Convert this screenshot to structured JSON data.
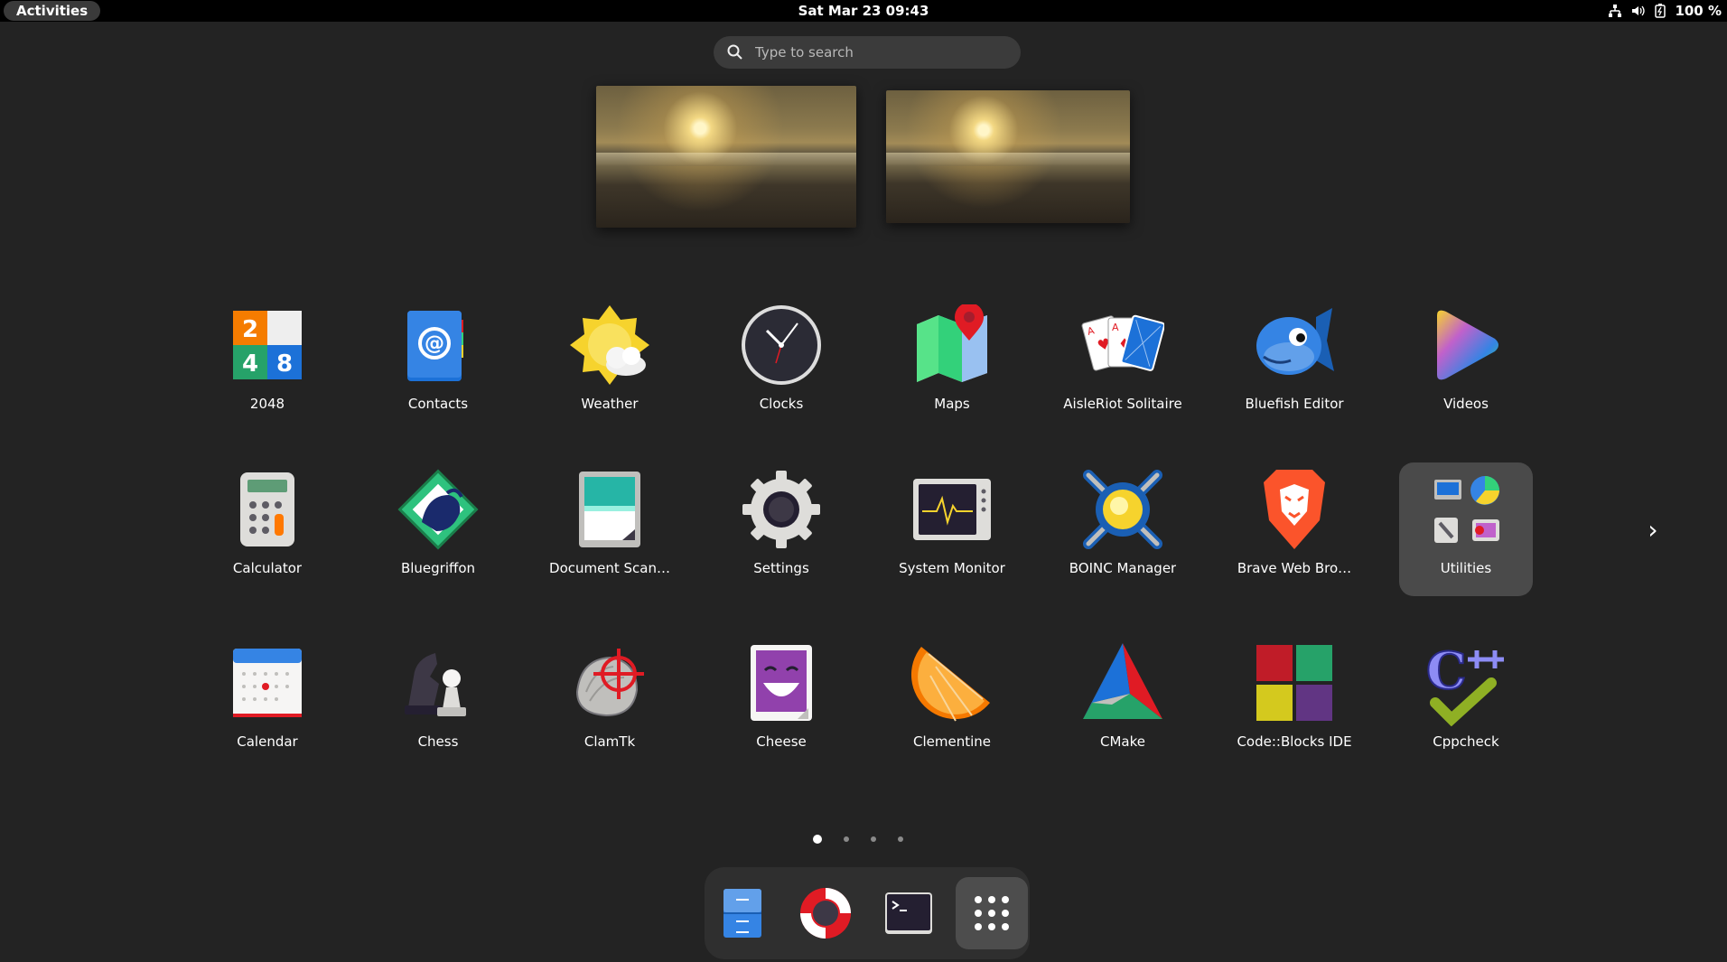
{
  "topbar": {
    "activities_label": "Activities",
    "clock": "Sat Mar 23  09:43",
    "battery": "100 %",
    "icons": [
      "network-icon",
      "volume-icon",
      "battery-icon"
    ]
  },
  "search": {
    "placeholder": "Type to search"
  },
  "apps": [
    {
      "label": "2048",
      "icon": "2048-icon"
    },
    {
      "label": "Contacts",
      "icon": "contacts-icon"
    },
    {
      "label": "Weather",
      "icon": "weather-icon"
    },
    {
      "label": "Clocks",
      "icon": "clock-icon"
    },
    {
      "label": "Maps",
      "icon": "maps-icon"
    },
    {
      "label": "AisleRiot Solitaire",
      "icon": "cards-icon"
    },
    {
      "label": "Bluefish Editor",
      "icon": "bluefish-icon"
    },
    {
      "label": "Videos",
      "icon": "videos-icon"
    },
    {
      "label": "Calculator",
      "icon": "calculator-icon"
    },
    {
      "label": "Bluegriffon",
      "icon": "bluegriffon-icon"
    },
    {
      "label": "Document Scan…",
      "icon": "scanner-icon"
    },
    {
      "label": "Settings",
      "icon": "gear-icon"
    },
    {
      "label": "System Monitor",
      "icon": "monitor-icon"
    },
    {
      "label": "BOINC Manager",
      "icon": "boinc-icon"
    },
    {
      "label": "Brave Web Bro…",
      "icon": "brave-icon"
    },
    {
      "label": "Utilities",
      "icon": "folder-icon"
    },
    {
      "label": "Calendar",
      "icon": "calendar-icon"
    },
    {
      "label": "Chess",
      "icon": "chess-icon"
    },
    {
      "label": "ClamTk",
      "icon": "clamtk-icon"
    },
    {
      "label": "Cheese",
      "icon": "cheese-icon"
    },
    {
      "label": "Clementine",
      "icon": "clementine-icon"
    },
    {
      "label": "CMake",
      "icon": "cmake-icon"
    },
    {
      "label": "Code::Blocks IDE",
      "icon": "codeblocks-icon"
    },
    {
      "label": "Cppcheck",
      "icon": "cppcheck-icon"
    }
  ],
  "pages": {
    "count": 4,
    "current": 1
  },
  "dash": [
    "files-icon",
    "help-icon",
    "terminal-icon",
    "app-grid-icon"
  ],
  "colors": {
    "background": "#232323",
    "topbar": "#000000",
    "folder": "#4a4a4a"
  }
}
